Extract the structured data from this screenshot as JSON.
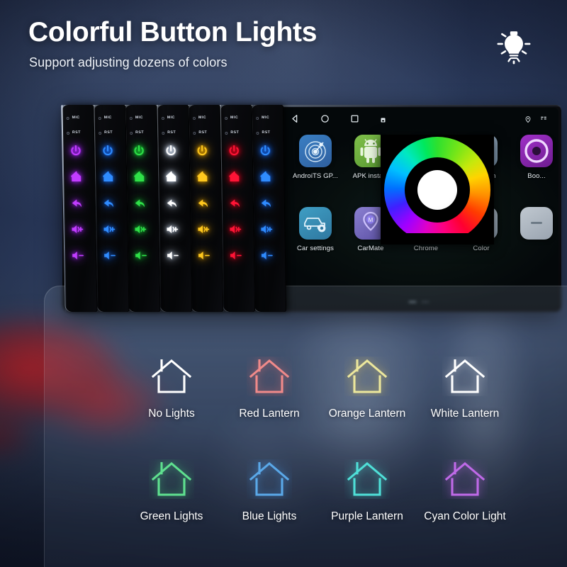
{
  "header": {
    "title": "Colorful Button Lights",
    "subtitle": "Support adjusting dozens of colors",
    "icon": "light-bulb-icon"
  },
  "device": {
    "panel_labels": {
      "mic": "MIC",
      "rst": "RST"
    },
    "panel_buttons": [
      "power-icon",
      "home-icon",
      "back-icon",
      "volume-up-icon",
      "volume-down-icon"
    ],
    "panels": [
      {
        "name": "purple-panel",
        "color": "#c23cff",
        "glow": "#8a1fd0"
      },
      {
        "name": "blue-panel",
        "color": "#2f8cff",
        "glow": "#1256c8"
      },
      {
        "name": "green-panel",
        "color": "#2fe048",
        "glow": "#13a82c"
      },
      {
        "name": "white-panel",
        "color": "#ffffff",
        "glow": "#b9c6d8"
      },
      {
        "name": "yellow-panel",
        "color": "#ffc81e",
        "glow": "#c08800"
      },
      {
        "name": "red-panel",
        "color": "#ff1436",
        "glow": "#c00018"
      },
      {
        "name": "blue2-panel",
        "color": "#2f8cff",
        "glow": "#1256c8"
      }
    ],
    "screen": {
      "nav": [
        "back-triangle-icon",
        "home-circle-icon",
        "recents-square-icon",
        "screenshot-icon"
      ],
      "status": [
        "location-pin-icon",
        "signal-icon"
      ],
      "apps": [
        {
          "label": "AndroiTS GP...",
          "icon": "gps-radar-icon",
          "bg1": "#3a7fc4",
          "bg2": "#2f5f9e"
        },
        {
          "label": "APK insta...",
          "icon": "android-robot-icon",
          "bg1": "#7fbf4a",
          "bg2": "#5a9a32"
        },
        {
          "label": "Chrome",
          "icon": "chrome-icon",
          "bg1": "#4a90d9",
          "bg2": "#3a70b0"
        },
        {
          "label": "Bluetooth",
          "icon": "bluetooth-icon",
          "bg1": "#9fb4c8",
          "bg2": "#7f98b0"
        },
        {
          "label": "Boo...",
          "icon": "booking-icon",
          "bg1": "#a030c8",
          "bg2": "#6e1c90"
        },
        {
          "label": "Car settings",
          "icon": "car-gear-icon",
          "bg1": "#3f9ec4",
          "bg2": "#2f78a0"
        },
        {
          "label": "CarMate",
          "icon": "carmate-pin-icon",
          "bg1": "#8a7fd0",
          "bg2": "#5f54a8"
        },
        {
          "label": "Color",
          "icon": "color-pinwheel-icon",
          "bg1": "#b8c4d0",
          "bg2": "#94a4b4"
        },
        {
          "label": "",
          "icon": "generic-app-icon",
          "bg1": "#c0c8d0",
          "bg2": "#9aa4b0"
        }
      ],
      "page_dots": 2,
      "active_dot": 1,
      "color_wheel": {
        "name": "color-wheel-picker",
        "center_color": "#ffffff",
        "ring_colors": [
          "#2ee02e",
          "#ffd400",
          "#ff3c00",
          "#ff0080",
          "#a000ff",
          "#0070ff",
          "#00c0ff",
          "#00e85c"
        ]
      }
    }
  },
  "card": {
    "options": [
      {
        "label": "No Lights",
        "color": "#ffffff",
        "glow": "rgba(255,255,255,0)"
      },
      {
        "label": "Red Lantern",
        "color": "#f08a8a",
        "glow": "rgba(240,110,110,.45)"
      },
      {
        "label": "Orange Lantern",
        "color": "#ece79c",
        "glow": "rgba(230,200,90,.45)"
      },
      {
        "label": "White Lantern",
        "color": "#ffffff",
        "glow": "rgba(255,255,255,.35)"
      },
      {
        "label": "Green Lights",
        "color": "#5fe08f",
        "glow": "rgba(70,220,130,.45)"
      },
      {
        "label": "Blue Lights",
        "color": "#5aa8e8",
        "glow": "rgba(70,150,235,.45)"
      },
      {
        "label": "Purple Lantern",
        "color": "#4fe0d8",
        "glow": "rgba(70,225,215,.45)"
      },
      {
        "label": "Cyan Color Light",
        "color": "#c06ae8",
        "glow": "rgba(190,100,235,.45)"
      }
    ]
  }
}
